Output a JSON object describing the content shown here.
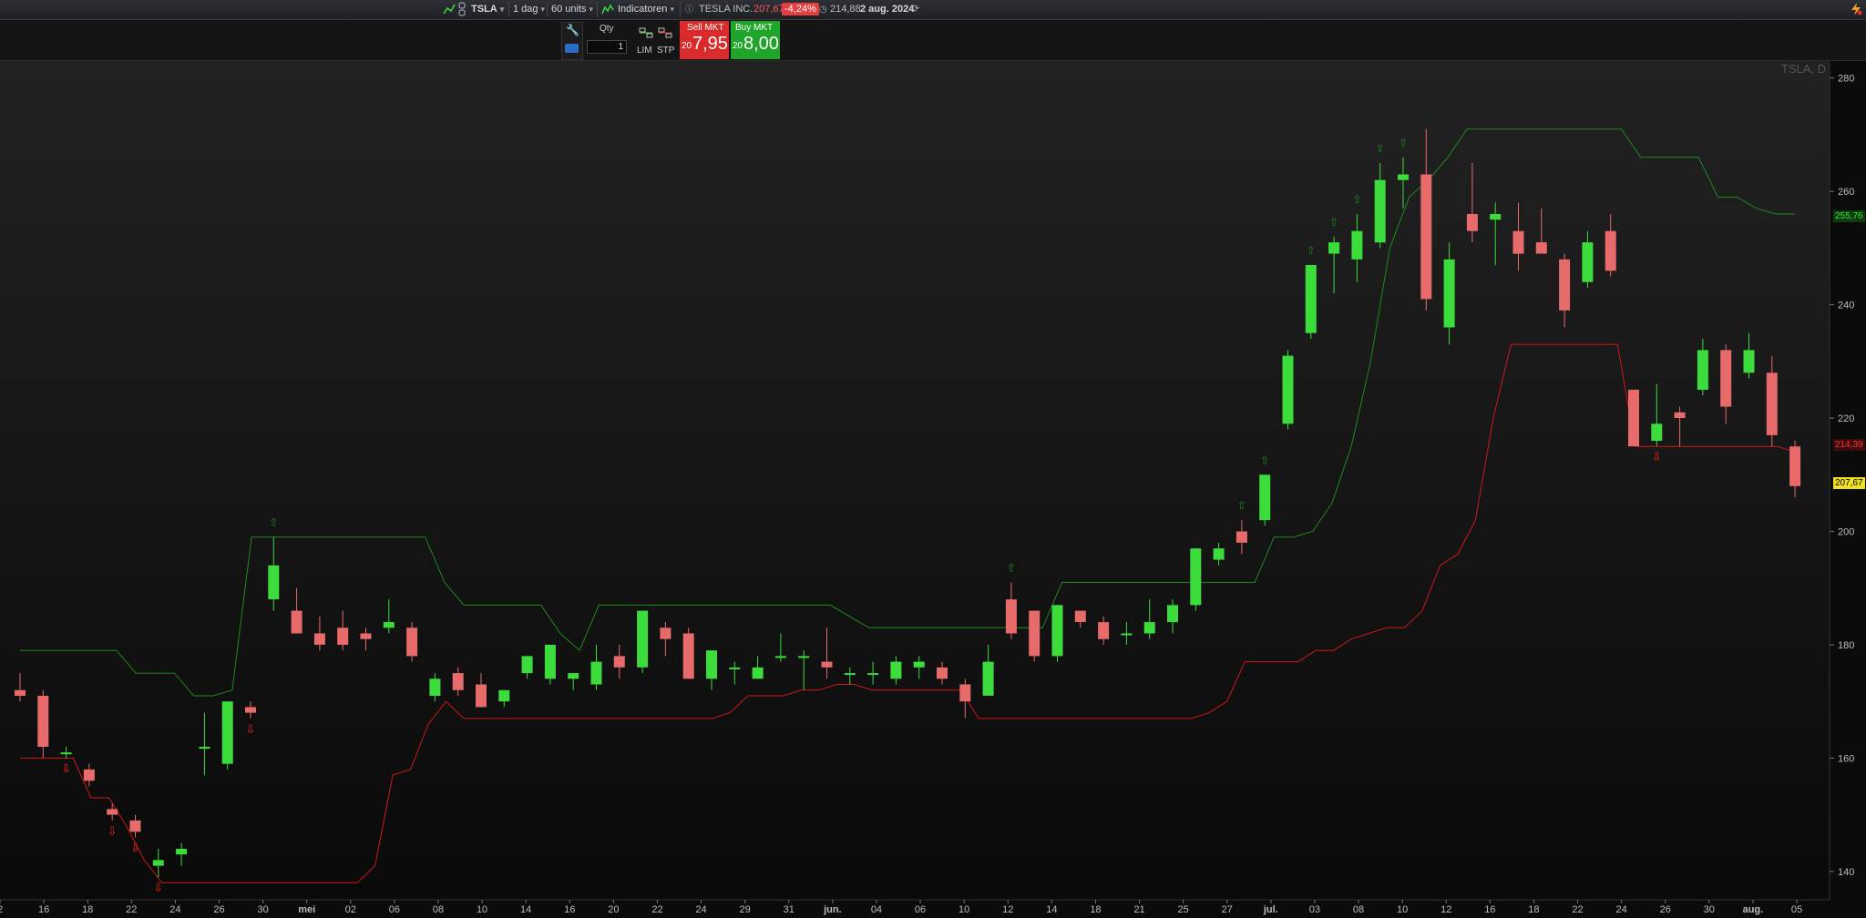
{
  "toolbar": {
    "symbol": "TSLA",
    "timeframe": "1 dag",
    "units": "60 units",
    "indicators": "Indicatoren",
    "instrument_name": "TESLA INC.",
    "last_price": "207,67",
    "change_pct": "-4,24%",
    "prev_price": "214,88",
    "date": "2 aug. 2024"
  },
  "order": {
    "qty_label": "Qty",
    "qty_value": "1",
    "lim_label": "LIM",
    "stp_label": "STP",
    "sell_label": "Sell MKT",
    "sell_prefix": "20",
    "sell_price": "7,95",
    "buy_label": "Buy MKT",
    "buy_prefix": "20",
    "buy_price": "8,00"
  },
  "chart": {
    "symbol_label": "TSLA, D",
    "colors": {
      "up": "#3ddc3d",
      "down": "#e86b6b",
      "upper_band": "#1e8a1e",
      "lower_band": "#d01818",
      "last_tag": "#f0e020"
    }
  },
  "chart_data": {
    "type": "candlestick",
    "title": "TSLA, D",
    "ylim": [
      135,
      283
    ],
    "y_ticks": [
      "280",
      "260",
      "240",
      "220",
      "200",
      "180",
      "160",
      "140"
    ],
    "x_ticks": [
      "2",
      "16",
      "18",
      "22",
      "24",
      "26",
      "30",
      "mei",
      "02",
      "06",
      "08",
      "10",
      "14",
      "16",
      "20",
      "22",
      "24",
      "29",
      "31",
      "jun.",
      "04",
      "06",
      "10",
      "12",
      "14",
      "18",
      "21",
      "25",
      "27",
      "jul.",
      "03",
      "08",
      "10",
      "12",
      "16",
      "18",
      "22",
      "24",
      "26",
      "30",
      "aug.",
      "05"
    ],
    "price_tags": {
      "upper_band": "255,76",
      "lower_band": "214,39",
      "last": "207,67"
    },
    "candles": [
      {
        "d": "2024-04-11",
        "o": 172,
        "h": 175,
        "l": 170,
        "c": 171
      },
      {
        "d": "2024-04-12",
        "o": 171,
        "h": 172,
        "l": 160,
        "c": 162
      },
      {
        "d": "2024-04-15",
        "o": 161,
        "h": 162,
        "l": 160,
        "c": 161
      },
      {
        "d": "2024-04-16",
        "o": 158,
        "h": 159,
        "l": 155,
        "c": 156
      },
      {
        "d": "2024-04-17",
        "o": 151,
        "h": 152,
        "l": 149,
        "c": 150
      },
      {
        "d": "2024-04-18",
        "o": 149,
        "h": 150,
        "l": 146,
        "c": 147
      },
      {
        "d": "2024-04-19",
        "o": 141,
        "h": 144,
        "l": 139,
        "c": 142
      },
      {
        "d": "2024-04-22",
        "o": 143,
        "h": 145,
        "l": 141,
        "c": 144
      },
      {
        "d": "2024-04-23",
        "o": 162,
        "h": 168,
        "l": 157,
        "c": 162
      },
      {
        "d": "2024-04-24",
        "o": 159,
        "h": 170,
        "l": 158,
        "c": 170
      },
      {
        "d": "2024-04-25",
        "o": 169,
        "h": 170,
        "l": 167,
        "c": 168
      },
      {
        "d": "2024-04-29",
        "o": 188,
        "h": 199,
        "l": 186,
        "c": 194
      },
      {
        "d": "2024-04-30",
        "o": 186,
        "h": 190,
        "l": 182,
        "c": 182
      },
      {
        "d": "2024-05-01",
        "o": 182,
        "h": 185,
        "l": 179,
        "c": 180
      },
      {
        "d": "2024-05-02",
        "o": 183,
        "h": 186,
        "l": 179,
        "c": 180
      },
      {
        "d": "2024-05-03",
        "o": 182,
        "h": 183,
        "l": 179,
        "c": 181
      },
      {
        "d": "2024-05-06",
        "o": 183,
        "h": 188,
        "l": 182,
        "c": 184
      },
      {
        "d": "2024-05-07",
        "o": 183,
        "h": 184,
        "l": 177,
        "c": 178
      },
      {
        "d": "2024-05-08",
        "o": 171,
        "h": 175,
        "l": 170,
        "c": 174
      },
      {
        "d": "2024-05-09",
        "o": 175,
        "h": 176,
        "l": 171,
        "c": 172
      },
      {
        "d": "2024-05-10",
        "o": 173,
        "h": 175,
        "l": 169,
        "c": 169
      },
      {
        "d": "2024-05-13",
        "o": 170,
        "h": 172,
        "l": 169,
        "c": 172
      },
      {
        "d": "2024-05-14",
        "o": 175,
        "h": 178,
        "l": 174,
        "c": 178
      },
      {
        "d": "2024-05-15",
        "o": 174,
        "h": 180,
        "l": 173,
        "c": 180
      },
      {
        "d": "2024-05-16",
        "o": 174,
        "h": 175,
        "l": 172,
        "c": 175
      },
      {
        "d": "2024-05-17",
        "o": 173,
        "h": 180,
        "l": 172,
        "c": 177
      },
      {
        "d": "2024-05-20",
        "o": 178,
        "h": 180,
        "l": 174,
        "c": 176
      },
      {
        "d": "2024-05-21",
        "o": 176,
        "h": 186,
        "l": 175,
        "c": 186
      },
      {
        "d": "2024-05-22",
        "o": 183,
        "h": 184,
        "l": 178,
        "c": 181
      },
      {
        "d": "2024-05-23",
        "o": 182,
        "h": 183,
        "l": 174,
        "c": 174
      },
      {
        "d": "2024-05-24",
        "o": 174,
        "h": 179,
        "l": 172,
        "c": 179
      },
      {
        "d": "2024-05-28",
        "o": 176,
        "h": 177,
        "l": 173,
        "c": 176
      },
      {
        "d": "2024-05-29",
        "o": 174,
        "h": 178,
        "l": 174,
        "c": 176
      },
      {
        "d": "2024-05-30",
        "o": 178,
        "h": 182,
        "l": 177,
        "c": 178
      },
      {
        "d": "2024-05-31",
        "o": 178,
        "h": 179,
        "l": 172,
        "c": 178
      },
      {
        "d": "2024-06-03",
        "o": 177,
        "h": 183,
        "l": 174,
        "c": 176
      },
      {
        "d": "2024-06-04",
        "o": 175,
        "h": 176,
        "l": 173,
        "c": 175
      },
      {
        "d": "2024-06-05",
        "o": 175,
        "h": 177,
        "l": 173,
        "c": 175
      },
      {
        "d": "2024-06-06",
        "o": 174,
        "h": 178,
        "l": 173,
        "c": 177
      },
      {
        "d": "2024-06-07",
        "o": 176,
        "h": 178,
        "l": 174,
        "c": 177
      },
      {
        "d": "2024-06-10",
        "o": 176,
        "h": 177,
        "l": 173,
        "c": 174
      },
      {
        "d": "2024-06-11",
        "o": 173,
        "h": 174,
        "l": 167,
        "c": 170
      },
      {
        "d": "2024-06-12",
        "o": 171,
        "h": 180,
        "l": 171,
        "c": 177
      },
      {
        "d": "2024-06-13",
        "o": 188,
        "h": 191,
        "l": 181,
        "c": 182
      },
      {
        "d": "2024-06-14",
        "o": 186,
        "h": 186,
        "l": 177,
        "c": 178
      },
      {
        "d": "2024-06-17",
        "o": 178,
        "h": 187,
        "l": 177,
        "c": 187
      },
      {
        "d": "2024-06-18",
        "o": 186,
        "h": 186,
        "l": 183,
        "c": 184
      },
      {
        "d": "2024-06-20",
        "o": 184,
        "h": 185,
        "l": 180,
        "c": 181
      },
      {
        "d": "2024-06-21",
        "o": 182,
        "h": 184,
        "l": 180,
        "c": 182
      },
      {
        "d": "2024-06-24",
        "o": 182,
        "h": 188,
        "l": 181,
        "c": 184
      },
      {
        "d": "2024-06-25",
        "o": 184,
        "h": 188,
        "l": 182,
        "c": 187
      },
      {
        "d": "2024-06-26",
        "o": 187,
        "h": 197,
        "l": 186,
        "c": 197
      },
      {
        "d": "2024-06-27",
        "o": 195,
        "h": 198,
        "l": 194,
        "c": 197
      },
      {
        "d": "2024-06-28",
        "o": 200,
        "h": 202,
        "l": 196,
        "c": 198
      },
      {
        "d": "2024-07-01",
        "o": 202,
        "h": 210,
        "l": 201,
        "c": 210
      },
      {
        "d": "2024-07-02",
        "o": 219,
        "h": 232,
        "l": 218,
        "c": 231
      },
      {
        "d": "2024-07-03",
        "o": 235,
        "h": 247,
        "l": 234,
        "c": 247
      },
      {
        "d": "2024-07-05",
        "o": 249,
        "h": 252,
        "l": 242,
        "c": 251
      },
      {
        "d": "2024-07-08",
        "o": 248,
        "h": 256,
        "l": 244,
        "c": 253
      },
      {
        "d": "2024-07-09",
        "o": 251,
        "h": 265,
        "l": 250,
        "c": 262
      },
      {
        "d": "2024-07-10",
        "o": 262,
        "h": 266,
        "l": 257,
        "c": 263
      },
      {
        "d": "2024-07-11",
        "o": 263,
        "h": 271,
        "l": 239,
        "c": 241
      },
      {
        "d": "2024-07-12",
        "o": 236,
        "h": 251,
        "l": 233,
        "c": 248
      },
      {
        "d": "2024-07-15",
        "o": 256,
        "h": 265,
        "l": 251,
        "c": 253
      },
      {
        "d": "2024-07-16",
        "o": 255,
        "h": 258,
        "l": 247,
        "c": 256
      },
      {
        "d": "2024-07-17",
        "o": 253,
        "h": 258,
        "l": 246,
        "c": 249
      },
      {
        "d": "2024-07-18",
        "o": 251,
        "h": 257,
        "l": 249,
        "c": 249
      },
      {
        "d": "2024-07-19",
        "o": 248,
        "h": 249,
        "l": 236,
        "c": 239
      },
      {
        "d": "2024-07-22",
        "o": 244,
        "h": 253,
        "l": 243,
        "c": 251
      },
      {
        "d": "2024-07-23",
        "o": 253,
        "h": 256,
        "l": 245,
        "c": 246
      },
      {
        "d": "2024-07-24",
        "o": 225,
        "h": 225,
        "l": 215,
        "c": 215
      },
      {
        "d": "2024-07-25",
        "o": 216,
        "h": 226,
        "l": 215,
        "c": 219
      },
      {
        "d": "2024-07-26",
        "o": 221,
        "h": 222,
        "l": 215,
        "c": 220
      },
      {
        "d": "2024-07-29",
        "o": 225,
        "h": 234,
        "l": 224,
        "c": 232
      },
      {
        "d": "2024-07-30",
        "o": 232,
        "h": 233,
        "l": 219,
        "c": 222
      },
      {
        "d": "2024-07-31",
        "o": 228,
        "h": 235,
        "l": 227,
        "c": 232
      },
      {
        "d": "2024-08-01",
        "o": 228,
        "h": 231,
        "l": 215,
        "c": 217
      },
      {
        "d": "2024-08-02",
        "o": 215,
        "h": 216,
        "l": 206,
        "c": 208
      }
    ],
    "upper_band": [
      179,
      179,
      179,
      179,
      179,
      179,
      175,
      175,
      175,
      171,
      171,
      172,
      199,
      199,
      199,
      199,
      199,
      199,
      199,
      199,
      199,
      199,
      191,
      187,
      187,
      187,
      187,
      187,
      182,
      179,
      187,
      187,
      187,
      187,
      187,
      187,
      187,
      187,
      187,
      187,
      187,
      187,
      187,
      185,
      183,
      183,
      183,
      183,
      183,
      183,
      183,
      183,
      183,
      183,
      191,
      191,
      191,
      191,
      191,
      191,
      191,
      191,
      191,
      191,
      191,
      199,
      199,
      200,
      205,
      215,
      230,
      250,
      259,
      262,
      266,
      271,
      271,
      271,
      271,
      271,
      271,
      271,
      271,
      271,
      266,
      266,
      266,
      266,
      259,
      259,
      257,
      256,
      256
    ],
    "lower_band": [
      160,
      160,
      160,
      160,
      153,
      153,
      148,
      142,
      138,
      138,
      138,
      138,
      138,
      138,
      138,
      138,
      138,
      138,
      138,
      138,
      141,
      157,
      158,
      166,
      170,
      167,
      167,
      167,
      167,
      167,
      167,
      167,
      167,
      167,
      167,
      167,
      167,
      167,
      167,
      167,
      168,
      171,
      171,
      171,
      172,
      172,
      173,
      173,
      172,
      172,
      172,
      172,
      172,
      172,
      167,
      167,
      167,
      167,
      167,
      167,
      167,
      167,
      167,
      167,
      167,
      167,
      167,
      168,
      170,
      177,
      177,
      177,
      177,
      179,
      179,
      181,
      182,
      183,
      183,
      186,
      194,
      196,
      202,
      220,
      233,
      233,
      233,
      233,
      233,
      233,
      233,
      215,
      215,
      215,
      215,
      215,
      215,
      215,
      215,
      215,
      214
    ]
  }
}
